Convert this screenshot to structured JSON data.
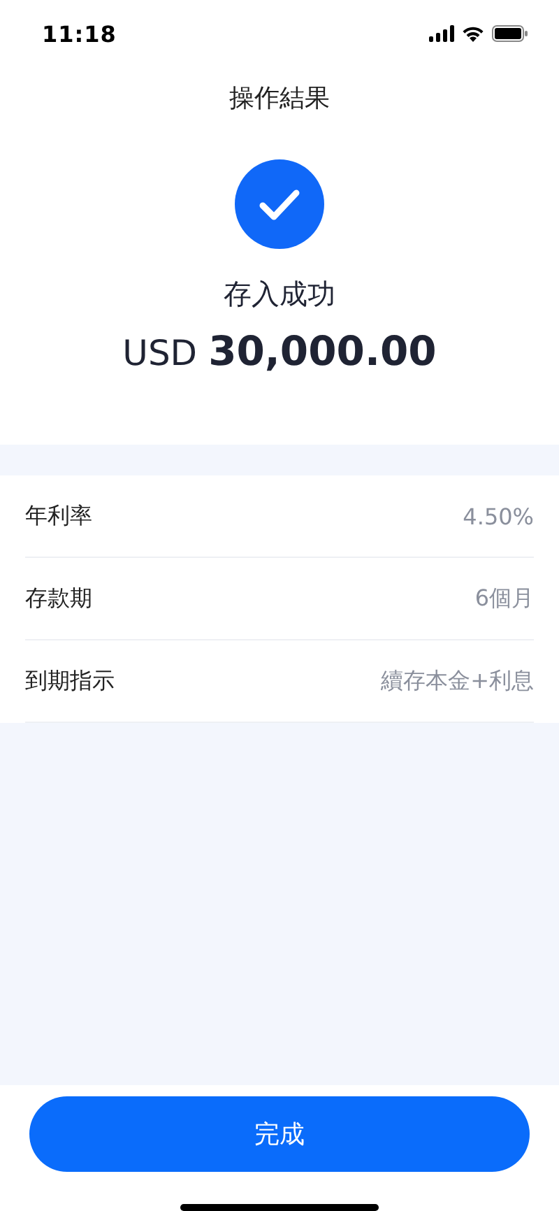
{
  "status_bar": {
    "time": "11:18"
  },
  "header": {
    "title": "操作結果"
  },
  "result": {
    "message": "存入成功",
    "currency": "USD",
    "amount": "30,000.00"
  },
  "details": [
    {
      "label": "年利率",
      "value": "4.50%"
    },
    {
      "label": "存款期",
      "value": "6個月"
    },
    {
      "label": "到期指示",
      "value": "續存本金+利息"
    }
  ],
  "button": {
    "label": "完成"
  }
}
